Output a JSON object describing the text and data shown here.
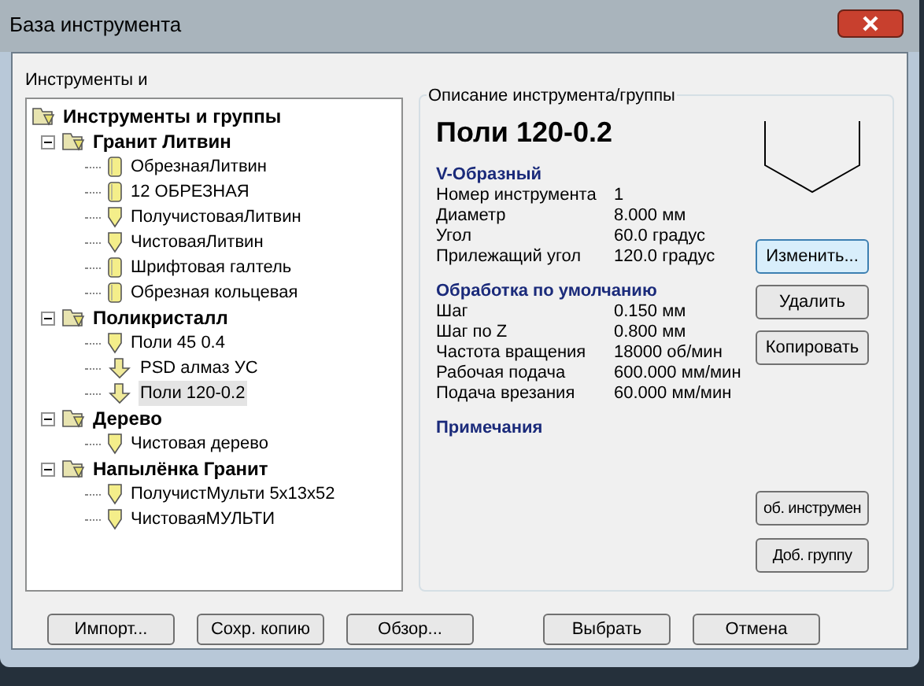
{
  "window": {
    "title": "База инструмента"
  },
  "tree_panel": {
    "label": "Инструменты и",
    "root": {
      "label": "Инструменты и группы",
      "children": [
        {
          "label": "Гранит Литвин",
          "expanded": true,
          "children": [
            {
              "label": "ОбрезнаяЛитвин",
              "kind": "cylinder",
              "selected": false
            },
            {
              "label": "12 ОБРЕЗНАЯ",
              "kind": "cylinder",
              "selected": false
            },
            {
              "label": "ПолучистоваяЛитвин",
              "kind": "vbit",
              "selected": false
            },
            {
              "label": "ЧистоваяЛитвин",
              "kind": "vbit",
              "selected": false
            },
            {
              "label": "Шрифтовая галтель",
              "kind": "cylinder",
              "selected": false
            },
            {
              "label": "Обрезная кольцевая",
              "kind": "cylinder",
              "selected": false
            }
          ]
        },
        {
          "label": "Поликристалл",
          "expanded": true,
          "children": [
            {
              "label": "Поли 45 0.4",
              "kind": "vbit",
              "selected": false
            },
            {
              "label": "PSD алмаз УС",
              "kind": "drill",
              "selected": false
            },
            {
              "label": "Поли 120-0.2",
              "kind": "drill",
              "selected": true
            }
          ]
        },
        {
          "label": "Дерево",
          "expanded": true,
          "children": [
            {
              "label": "Чистовая дерево",
              "kind": "vbit",
              "selected": false
            }
          ]
        },
        {
          "label": "Напылёнка Гранит",
          "expanded": true,
          "children": [
            {
              "label": "ПолучистМульти 5х13х52",
              "kind": "vbit",
              "selected": false
            },
            {
              "label": "ЧистоваяМУЛЬТИ",
              "kind": "vbit",
              "selected": false
            }
          ]
        }
      ]
    }
  },
  "details": {
    "label": "Описание инструмента/группы",
    "tool_name": "Поли 120-0.2",
    "sections": [
      {
        "heading": "V-Образный",
        "rows": [
          {
            "name": "Номер инструмента",
            "value": "1"
          },
          {
            "name": "Диаметр",
            "value": "8.000 мм"
          },
          {
            "name": "Угол",
            "value": "60.0 градус"
          },
          {
            "name": "Прилежащий угол",
            "value": "120.0 градус"
          }
        ]
      },
      {
        "heading": "Обработка по умолчанию",
        "rows": [
          {
            "name": "Шаг",
            "value": "0.150 мм"
          },
          {
            "name": "Шаг по Z",
            "value": "0.800 мм"
          },
          {
            "name": "Частота вращения",
            "value": "18000 об/мин"
          },
          {
            "name": "Рабочая подача",
            "value": "600.000 мм/мин"
          },
          {
            "name": "Подача врезания",
            "value": "60.000 мм/мин"
          }
        ]
      },
      {
        "heading": "Примечания"
      }
    ],
    "buttons": [
      {
        "label": "Изменить...",
        "focused": true
      },
      {
        "label": "Удалить",
        "focused": false
      },
      {
        "label": "Копировать",
        "focused": false
      }
    ],
    "add_buttons": [
      "об. инструмен",
      "Доб. группу"
    ]
  },
  "footer_buttons": [
    "Импорт...",
    "Сохр. копию",
    "Обзор...",
    "Выбрать",
    "Отмена"
  ]
}
